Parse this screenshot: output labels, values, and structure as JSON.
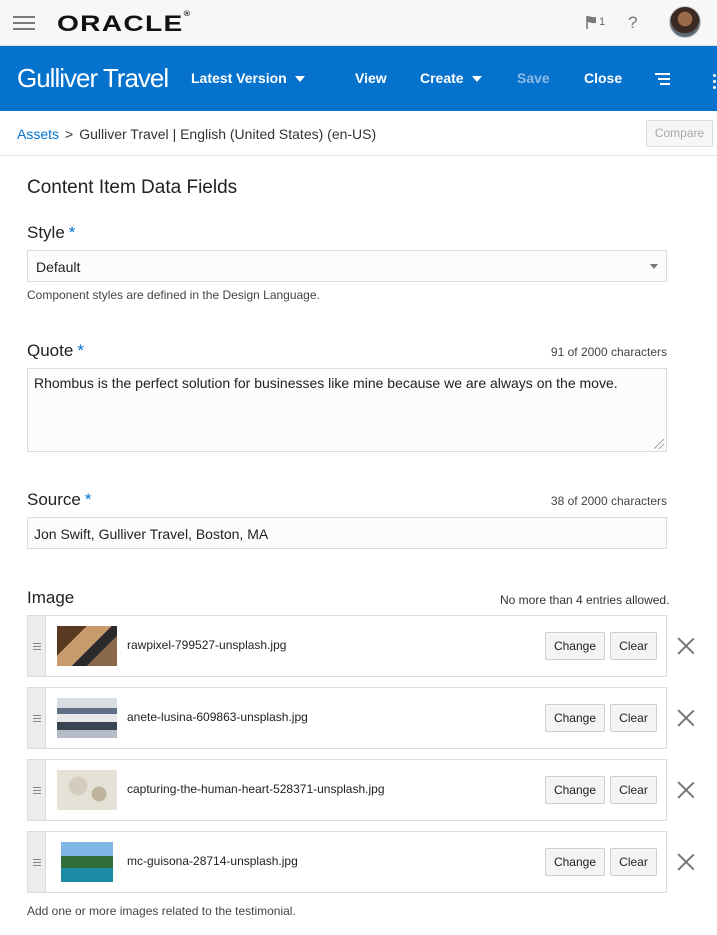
{
  "topbar": {
    "logo": "ORACLE",
    "logo_mark": "®",
    "notifications_count": "1",
    "help": "?"
  },
  "header": {
    "app_title": "Gulliver Travel",
    "version_label": "Latest Version",
    "view_label": "View",
    "create_label": "Create",
    "save_label": "Save",
    "close_label": "Close"
  },
  "breadcrumb": {
    "root": "Assets",
    "separator": ">",
    "item": "Gulliver Travel",
    "language": "| English (United States) (en-US)",
    "compare_label": "Compare"
  },
  "form": {
    "section_title": "Content Item Data Fields",
    "required_marker": "*",
    "style": {
      "label": "Style",
      "value": "Default",
      "help": "Component styles are defined in the Design Language."
    },
    "quote": {
      "label": "Quote",
      "count": "91 of 2000 characters",
      "value": "Rhombus is the perfect solution for businesses like mine because we are always on the move."
    },
    "source": {
      "label": "Source",
      "count": "38 of 2000 characters",
      "value": "Jon Swift, Gulliver Travel, Boston, MA"
    },
    "image": {
      "label": "Image",
      "limit": "No more than 4 entries allowed.",
      "change_label": "Change",
      "clear_label": "Clear",
      "items": [
        {
          "file": "rawpixel-799527-unsplash.jpg"
        },
        {
          "file": "anete-lusina-609863-unsplash.jpg"
        },
        {
          "file": "capturing-the-human-heart-528371-unsplash.jpg"
        },
        {
          "file": "mc-guisona-28714-unsplash.jpg"
        }
      ],
      "help": "Add one or more images related to the testimonial."
    }
  },
  "colors": {
    "brand_blue": "#0572ce",
    "required": "#0572ce"
  },
  "icons": [
    "hamburger-icon",
    "flag-icon",
    "help-icon",
    "avatar",
    "caret-down-icon",
    "list-menu-icon",
    "kebab-icon",
    "drag-handle-icon",
    "close-icon"
  ]
}
